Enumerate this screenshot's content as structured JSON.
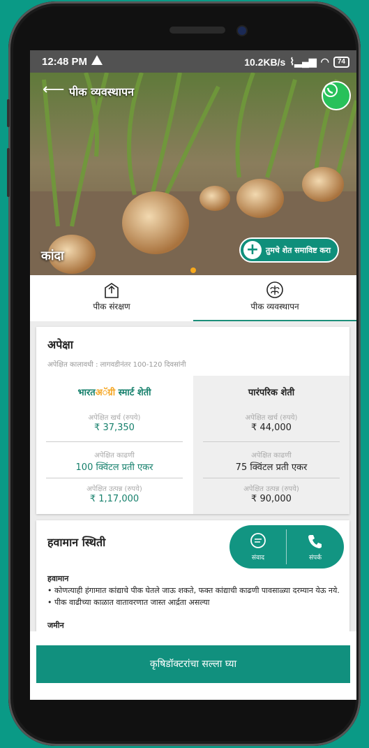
{
  "status_bar": {
    "time": "12:48 PM",
    "network_speed": "10.2KB/s",
    "battery": "74"
  },
  "header": {
    "title": "पीक व्यवस्थापन",
    "crop_name": "कांदा",
    "add_farm_label": "तुमचे शेत समाविष्ट करा"
  },
  "tabs": [
    {
      "label": "पीक संरक्षण",
      "icon": "crop-protection-icon",
      "active": false
    },
    {
      "label": "पीक व्यवस्थापन",
      "icon": "crop-management-icon",
      "active": true
    }
  ],
  "expectation": {
    "title": "अपेक्षा",
    "subtitle": "अपेक्षित कालावधी : लागवडीनंतर 100-120 दिवसांनी",
    "smart": {
      "brand_part1": "भारत",
      "brand_part2": "अॅग्री",
      "brand_part3": " स्मार्ट शेती",
      "metrics": [
        {
          "label": "अपेक्षित खर्च (रुपये)",
          "value": "₹ 37,350"
        },
        {
          "label": "अपेक्षित काढणी",
          "value": "100 क्विंटल प्रती एकर"
        },
        {
          "label": "अपेक्षित उत्पन्न (रुपये)",
          "value": "₹ 1,17,000"
        }
      ]
    },
    "traditional": {
      "title": "पारंपरिक शेती",
      "metrics": [
        {
          "label": "अपेक्षित खर्च (रुपये)",
          "value": "₹ 44,000"
        },
        {
          "label": "अपेक्षित काढणी",
          "value": "75 क्विंटल प्रती एकर"
        },
        {
          "label": "अपेक्षित उत्पन्न (रुपये)",
          "value": "₹ 90,000"
        }
      ]
    }
  },
  "weather": {
    "title": "हवामान स्थिती",
    "subheading": "हवामान",
    "line1": "• कोणत्याही हंगामात कांद्याचे पीक घेतले जाऊ शकते, फक्त कांद्याची काढणी पावसाळ्या दरम्यान येऊ नये.",
    "line2": "• पीक वाढीच्या काळात वातावरणात जास्त आर्द्रता असल्या",
    "cut_heading": "जमीन"
  },
  "fab": {
    "chat_label": "संवाद",
    "call_label": "संपर्क"
  },
  "cta_label": "कृषिडॉक्टरांचा सल्ला घ्या",
  "colors": {
    "brand": "#11907e",
    "accent": "#f5a623",
    "background": "#0a9a86"
  }
}
